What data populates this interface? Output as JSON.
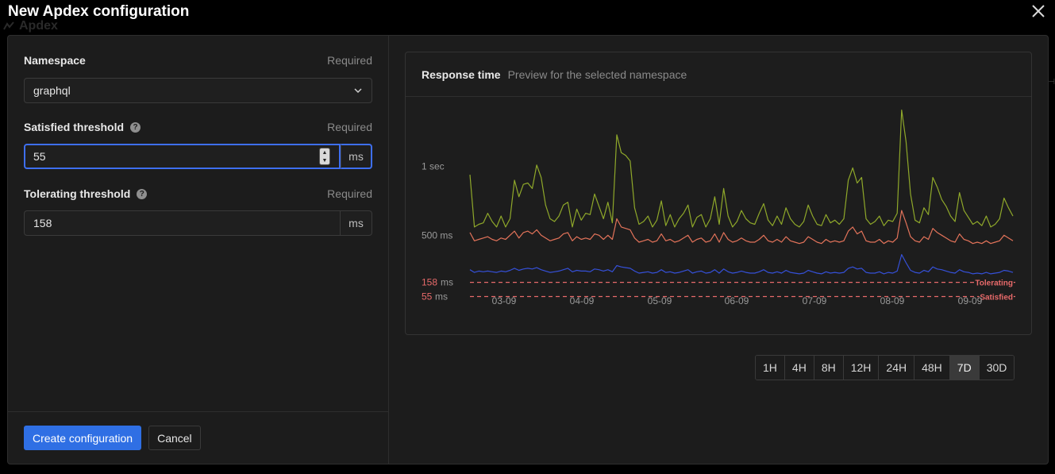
{
  "background": {
    "title": "Apdex"
  },
  "modal": {
    "title": "New Apdex configuration"
  },
  "form": {
    "namespace": {
      "label": "Namespace",
      "required": "Required",
      "value": "graphql"
    },
    "satisfied": {
      "label": "Satisfied threshold",
      "required": "Required",
      "value": "55",
      "unit": "ms",
      "help": "?"
    },
    "tolerating": {
      "label": "Tolerating threshold",
      "required": "Required",
      "value": "158",
      "unit": "ms",
      "help": "?"
    }
  },
  "footer": {
    "create_label": "Create configuration",
    "cancel_label": "Cancel"
  },
  "chart": {
    "title": "Response time",
    "subtitle": "Preview for the selected namespace"
  },
  "ranges": {
    "items": [
      "1H",
      "4H",
      "8H",
      "12H",
      "24H",
      "48H",
      "7D",
      "30D"
    ],
    "active": "7D"
  },
  "colors": {
    "accent": "#2f6fe4",
    "series_top": "#8fa82a",
    "series_mid": "#e3735a",
    "series_low": "#3550d8",
    "threshold": "#e86a6a"
  },
  "chart_data": {
    "type": "line",
    "title": "Response time",
    "subtitle": "Preview for the selected namespace",
    "x_tick_labels": [
      "03-09",
      "04-09",
      "05-09",
      "06-09",
      "07-09",
      "08-09",
      "09-09"
    ],
    "y_tick_labels": [
      "1 sec",
      "500 ms"
    ],
    "y_units": "ms",
    "y_range": [
      0,
      1500
    ],
    "series": [
      {
        "color": "#8fa82a",
        "values": [
          940,
          560,
          580,
          590,
          660,
          600,
          560,
          640,
          560,
          620,
          900,
          780,
          870,
          880,
          840,
          1010,
          920,
          720,
          620,
          600,
          640,
          720,
          740,
          560,
          690,
          610,
          660,
          650,
          800,
          710,
          620,
          740,
          590,
          1230,
          1100,
          1080,
          1040,
          700,
          580,
          600,
          640,
          560,
          610,
          750,
          570,
          650,
          560,
          620,
          660,
          720,
          560,
          630,
          650,
          560,
          620,
          780,
          580,
          840,
          640,
          560,
          600,
          680,
          620,
          590,
          580,
          660,
          730,
          610,
          570,
          640,
          580,
          700,
          620,
          580,
          560,
          600,
          720,
          640,
          580,
          570,
          650,
          590,
          610,
          580,
          620,
          900,
          990,
          880,
          920,
          620,
          580,
          600,
          640,
          570,
          610,
          600,
          660,
          1410,
          1180,
          800,
          610,
          590,
          700,
          650,
          920,
          850,
          760,
          710,
          640,
          600,
          810,
          680,
          630,
          580,
          600,
          570,
          640,
          560,
          580,
          620,
          770,
          700,
          640
        ]
      },
      {
        "color": "#e3735a",
        "values": [
          520,
          460,
          470,
          480,
          490,
          470,
          460,
          480,
          470,
          500,
          530,
          480,
          520,
          530,
          510,
          540,
          500,
          480,
          460,
          470,
          480,
          510,
          520,
          460,
          490,
          470,
          480,
          470,
          510,
          500,
          470,
          500,
          470,
          620,
          560,
          550,
          540,
          480,
          450,
          460,
          470,
          450,
          460,
          510,
          460,
          470,
          450,
          460,
          480,
          500,
          450,
          470,
          480,
          450,
          460,
          510,
          450,
          520,
          470,
          450,
          460,
          480,
          460,
          450,
          450,
          470,
          500,
          460,
          450,
          470,
          450,
          490,
          460,
          450,
          440,
          450,
          490,
          470,
          450,
          440,
          470,
          450,
          460,
          450,
          460,
          530,
          560,
          510,
          530,
          460,
          450,
          450,
          470,
          440,
          460,
          450,
          480,
          680,
          590,
          490,
          460,
          450,
          490,
          470,
          550,
          520,
          500,
          480,
          460,
          450,
          510,
          470,
          460,
          440,
          450,
          440,
          460,
          440,
          450,
          460,
          500,
          480,
          460
        ]
      },
      {
        "color": "#3550d8",
        "values": [
          250,
          230,
          240,
          235,
          240,
          235,
          230,
          240,
          235,
          245,
          260,
          245,
          255,
          260,
          255,
          265,
          250,
          240,
          230,
          235,
          240,
          250,
          260,
          235,
          245,
          240,
          240,
          235,
          255,
          250,
          240,
          250,
          235,
          280,
          270,
          265,
          260,
          240,
          225,
          230,
          235,
          225,
          230,
          250,
          230,
          235,
          225,
          230,
          240,
          250,
          225,
          235,
          240,
          225,
          230,
          250,
          225,
          255,
          235,
          225,
          230,
          240,
          230,
          225,
          225,
          235,
          250,
          230,
          225,
          235,
          225,
          245,
          230,
          225,
          220,
          225,
          245,
          235,
          225,
          220,
          235,
          225,
          230,
          225,
          230,
          260,
          270,
          255,
          260,
          230,
          225,
          225,
          235,
          220,
          230,
          225,
          240,
          360,
          300,
          245,
          230,
          225,
          245,
          235,
          270,
          255,
          250,
          240,
          230,
          225,
          250,
          235,
          230,
          220,
          225,
          220,
          230,
          220,
          225,
          230,
          245,
          240,
          230
        ]
      }
    ],
    "thresholds": [
      {
        "label": "Tolerating",
        "value": 158,
        "tick_value": "158",
        "tick_unit": "ms"
      },
      {
        "label": "Satisfied",
        "value": 55,
        "tick_value": "55",
        "tick_unit": "ms"
      }
    ]
  }
}
